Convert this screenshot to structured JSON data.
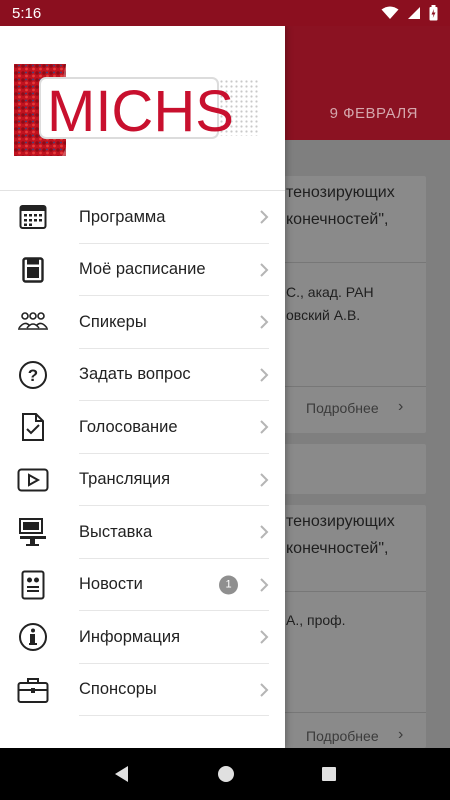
{
  "status_bar": {
    "time": "5:16"
  },
  "background": {
    "date": "9 ФЕВРАЛЯ",
    "card1": {
      "title_line1": "тенозирующих",
      "title_line2": "конечностей\",",
      "info_line1": "С., акад. РАН",
      "info_line2": "овский А.В.",
      "more_label": "Подробнее"
    },
    "card2": {
      "title_line1": "тенозирующих",
      "title_line2": "конечностей\",",
      "info_line1": "А., проф.",
      "more_label": "Подробнее"
    }
  },
  "drawer": {
    "logo_text": "MICHS",
    "menu": [
      {
        "label": "Программа",
        "icon": "calendar-icon"
      },
      {
        "label": "Моё расписание",
        "icon": "bookmark-icon"
      },
      {
        "label": "Спикеры",
        "icon": "people-icon"
      },
      {
        "label": "Задать вопрос",
        "icon": "question-icon"
      },
      {
        "label": "Голосование",
        "icon": "vote-document-icon"
      },
      {
        "label": "Трансляция",
        "icon": "play-icon"
      },
      {
        "label": "Выставка",
        "icon": "kiosk-icon"
      },
      {
        "label": "Новости",
        "icon": "news-icon",
        "badge": "1"
      },
      {
        "label": "Информация",
        "icon": "info-icon"
      },
      {
        "label": "Спонсоры",
        "icon": "briefcase-icon"
      }
    ]
  },
  "colors": {
    "brand": "#8b0f1f",
    "logo_red": "#c8102e"
  }
}
